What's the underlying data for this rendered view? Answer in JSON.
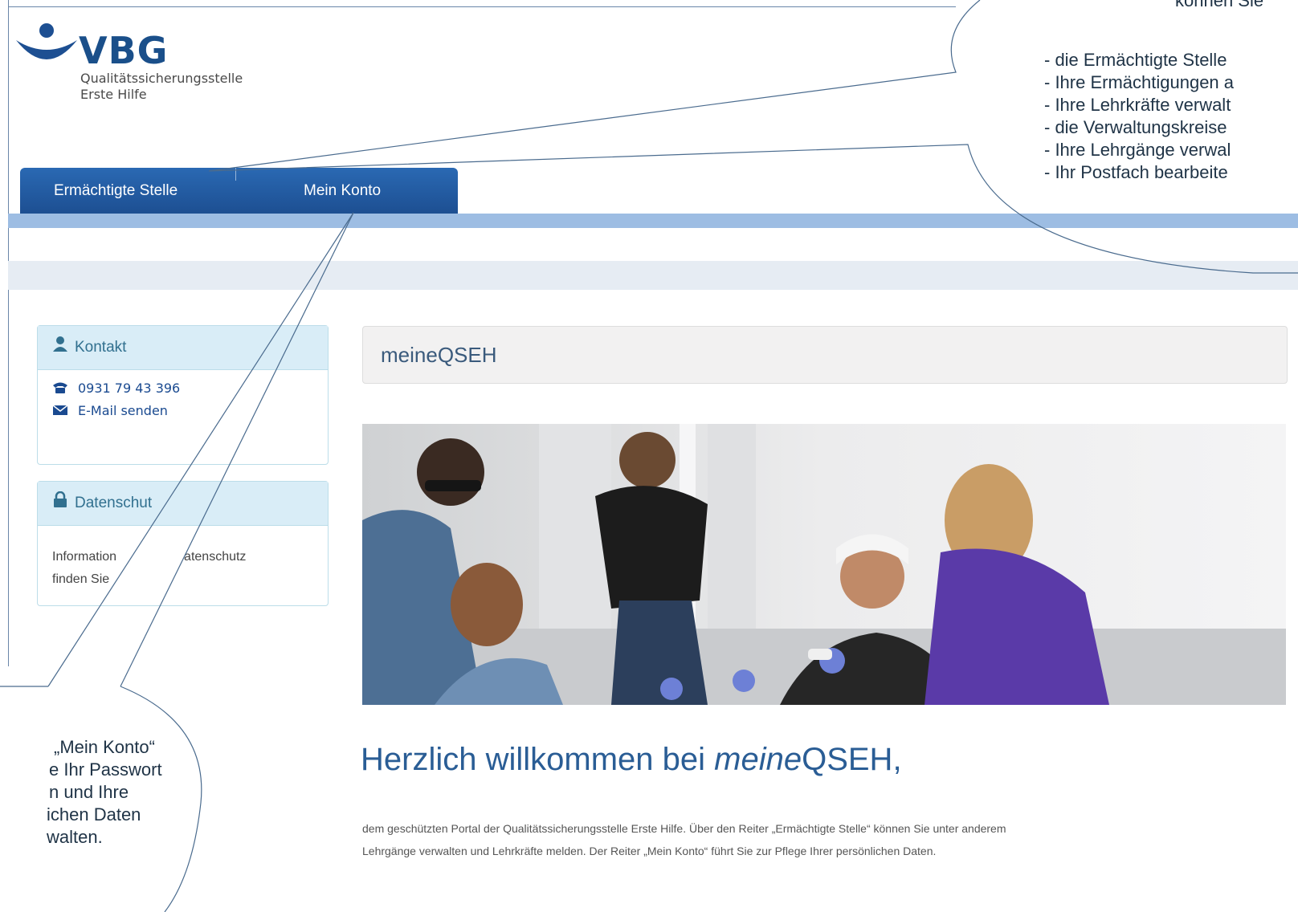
{
  "logo": {
    "wordmark": "VBG",
    "subtitle_line1": "Qualitätssicherungsstelle",
    "subtitle_line2": "Erste Hilfe"
  },
  "tabs": [
    {
      "label": "Ermächtigte Stelle"
    },
    {
      "label": "Mein Konto"
    }
  ],
  "sidebar": {
    "contact": {
      "title": "Kontakt",
      "phone": "0931 79 43 396",
      "email_link": "E-Mail senden"
    },
    "privacy": {
      "title": "Datenschut",
      "text_line1a": "Information",
      "text_line1b": "atenschutz",
      "text_line2": "finden Sie"
    }
  },
  "main": {
    "header_title": "meineQSEH",
    "welcome_prefix": "Herzlich willkommen bei ",
    "welcome_italic": "meine",
    "welcome_suffix": "QSEH,",
    "intro_line1": "dem geschützten Portal der Qualitätssicherungsstelle Erste Hilfe. Über den Reiter „Ermächtigte Stelle“ können Sie unter anderem",
    "intro_line2": "Lehrgänge verwalten und Lehrkräfte melden. Der Reiter „Mein Konto“ führt Sie zur Pflege Ihrer persönlichen Daten."
  },
  "callout_right": {
    "top_fragment": "können Sie",
    "items": [
      "- die Ermächtigte Stelle",
      "- Ihre Ermächtigungen a",
      "- Ihre Lehrkräfte verwalt",
      "- die Verwaltungskreise",
      "- Ihre Lehrgänge verwal",
      "- Ihr Postfach bearbeite"
    ]
  },
  "callout_left": {
    "lines": [
      "„Mein Konto“",
      "e Ihr Passwort",
      "n und Ihre",
      "ichen Daten",
      "walten."
    ]
  },
  "colors": {
    "brand_blue": "#1d4f92",
    "tab_line": "#9dbde3",
    "panel_head": "#d9edf7"
  },
  "icons": [
    "user-icon",
    "phone-icon",
    "envelope-icon",
    "lock-icon"
  ]
}
